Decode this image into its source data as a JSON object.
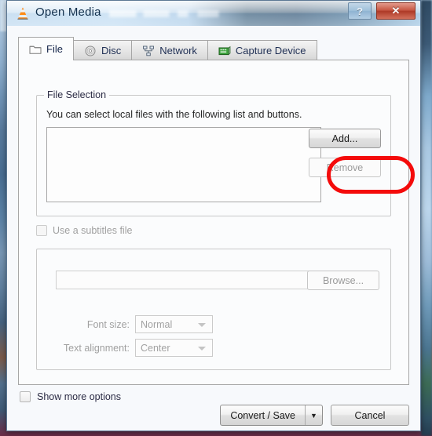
{
  "window": {
    "title": "Open Media",
    "app_icon": "vlc-cone-icon",
    "help_label": "?",
    "close_label": "✕",
    "accent_red": "#f40b0b",
    "titlebar_blue": "#2d4a60"
  },
  "tabs": [
    {
      "label": "File",
      "icon": "folder-icon",
      "active": true
    },
    {
      "label": "Disc",
      "icon": "disc-icon",
      "active": false
    },
    {
      "label": "Network",
      "icon": "network-icon",
      "active": false
    },
    {
      "label": "Capture Device",
      "icon": "capture-card-icon",
      "active": false
    }
  ],
  "file_selection": {
    "group_title": "File Selection",
    "helper_text": "You can select local files with the following list and buttons.",
    "list_items": [],
    "add_label": "Add...",
    "remove_label": "Remove",
    "remove_disabled": true,
    "highlight": "add-button-red-ring"
  },
  "subtitles": {
    "checkbox_label": "Use a subtitles file",
    "checked": false,
    "disabled": true,
    "path_value": "",
    "path_placeholder": "",
    "browse_label": "Browse...",
    "font_size_label": "Font size:",
    "font_size_value": "Normal",
    "text_alignment_label": "Text alignment:",
    "text_alignment_value": "Center"
  },
  "footer": {
    "show_more_label": "Show more options",
    "show_more_checked": false,
    "convert_save_label": "Convert / Save",
    "convert_save_arrow": "▼",
    "cancel_label": "Cancel"
  }
}
